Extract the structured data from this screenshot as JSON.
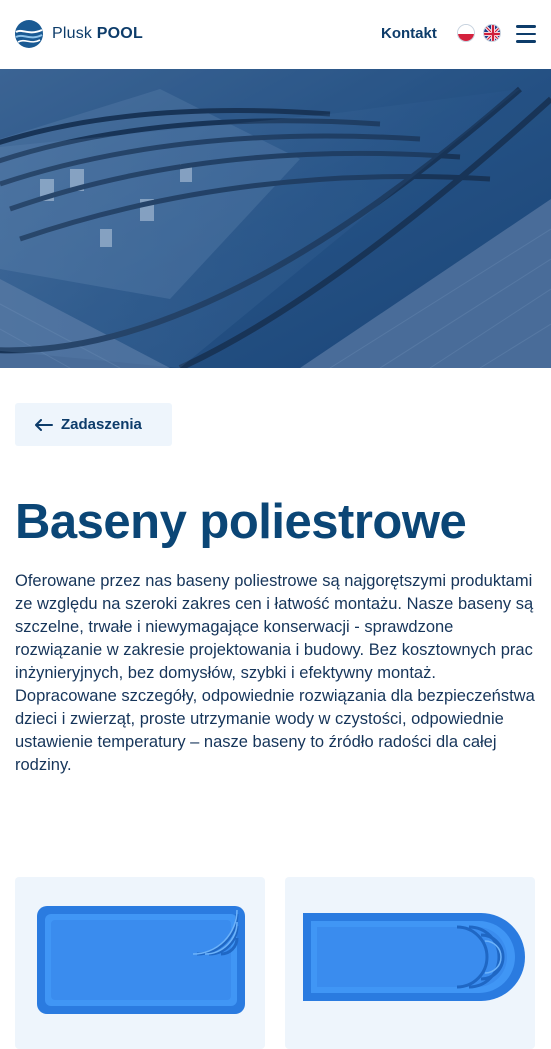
{
  "header": {
    "logo_light": "Plusk ",
    "logo_bold": "POOL",
    "contact_label": "Kontakt",
    "languages": [
      "pl-flag-icon",
      "uk-flag-icon"
    ],
    "menu_icon": "hamburger-icon"
  },
  "hero": {
    "image": "pool-enclosure-photo"
  },
  "back_button": {
    "label": "Zadaszenia",
    "icon": "arrow-left-icon"
  },
  "main": {
    "title": "Baseny poliestrowe",
    "description": "Oferowane przez nas baseny poliestrowe są najgorętszymi produktami ze względu na szeroki zakres cen i łatwość montażu. Nasze baseny są szczelne, trwałe i niewymagające konserwacji - sprawdzone rozwiązanie w zakresie projektowania i budowy. Bez kosztownych prac inżynieryjnych, bez domysłów, szybki i efektywny montaż. Dopracowane szczegóły, odpowiednie rozwiązania dla bezpieczeństwa dzieci i zwierząt, proste utrzymanie wody w czystości, odpowiednie ustawienie temperatury – nasze baseny to źródło radości dla całej rodziny."
  },
  "products": [
    {
      "image": "rectangular-pool-corner-steps"
    },
    {
      "image": "rectangular-pool-rounded-steps"
    }
  ],
  "colors": {
    "brand_dark": "#0d3c6a",
    "title": "#0b4676",
    "card_bg": "#eef5fc",
    "pool_blue": "#2f7fe0"
  }
}
